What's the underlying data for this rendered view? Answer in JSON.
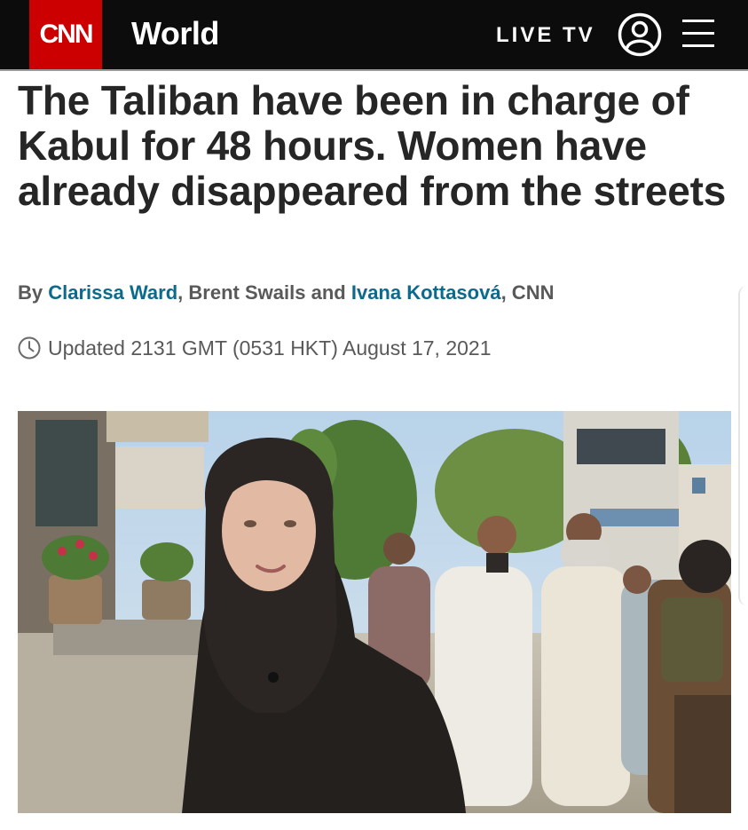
{
  "header": {
    "logo_text": "CNN",
    "section": "World",
    "live_tv_label": "LIVE TV",
    "profile_icon": "user-circle-icon",
    "menu_icon": "hamburger-menu-icon",
    "brand_color": "#cc0000"
  },
  "article": {
    "headline": "The Taliban have been in charge of Kabul for 48 hours. Women have already disappeared from the streets",
    "byline": {
      "prefix": "By",
      "author1": "Clarissa Ward",
      "sep1": ",",
      "author2": "Brent Swails",
      "and": "and",
      "author3": "Ivana Kottasová",
      "suffix": ", CNN"
    },
    "timestamp": "Updated 2131 GMT (0531 HKT) August 17, 2021",
    "timestamp_icon": "clock-icon"
  },
  "lead_image": {
    "subject": "photo"
  }
}
